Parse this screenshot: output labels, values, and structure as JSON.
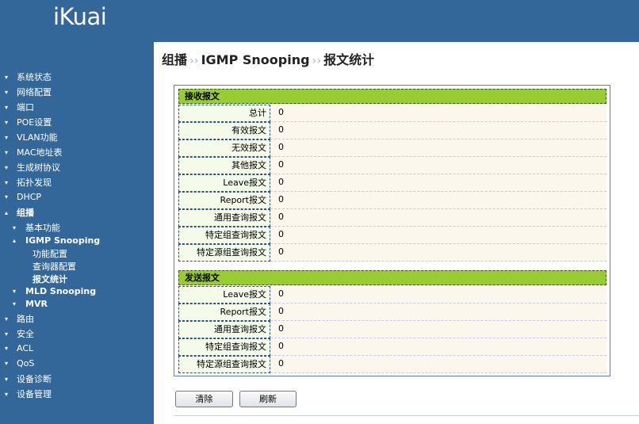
{
  "app": {
    "logo": "iKuai"
  },
  "breadcrumb": {
    "part1": "组播",
    "part2": "IGMP Snooping",
    "part3": "报文统计",
    "separator": "››"
  },
  "sidebar": {
    "items": [
      {
        "label": "系统状态",
        "arrow": "▾"
      },
      {
        "label": "网络配置",
        "arrow": "▾"
      },
      {
        "label": "端口",
        "arrow": "▾"
      },
      {
        "label": "POE设置",
        "arrow": "▾"
      },
      {
        "label": "VLAN功能",
        "arrow": "▾"
      },
      {
        "label": "MAC地址表",
        "arrow": "▾"
      },
      {
        "label": "生成树协议",
        "arrow": "▾"
      },
      {
        "label": "拓扑发现",
        "arrow": "▾"
      },
      {
        "label": "DHCP",
        "arrow": "▾"
      },
      {
        "label": "组播",
        "arrow": "▴"
      },
      {
        "label": "基本功能",
        "arrow": "▾"
      },
      {
        "label": "IGMP Snooping",
        "arrow": "▴"
      },
      {
        "label": "功能配置",
        "arrow": ""
      },
      {
        "label": "查询器配置",
        "arrow": ""
      },
      {
        "label": "报文统计",
        "arrow": ""
      },
      {
        "label": "MLD Snooping",
        "arrow": "▾"
      },
      {
        "label": "MVR",
        "arrow": "▾"
      },
      {
        "label": "路由",
        "arrow": "▾"
      },
      {
        "label": "安全",
        "arrow": "▾"
      },
      {
        "label": "ACL",
        "arrow": "▾"
      },
      {
        "label": "QoS",
        "arrow": "▾"
      },
      {
        "label": "设备诊断",
        "arrow": "▾"
      },
      {
        "label": "设备管理",
        "arrow": "▾"
      }
    ]
  },
  "receive": {
    "title": "接收报文",
    "rows": [
      {
        "label": "总计",
        "value": "0"
      },
      {
        "label": "有效报文",
        "value": "0"
      },
      {
        "label": "无效报文",
        "value": "0"
      },
      {
        "label": "其他报文",
        "value": "0"
      },
      {
        "label": "Leave报文",
        "value": "0"
      },
      {
        "label": "Report报文",
        "value": "0"
      },
      {
        "label": "通用查询报文",
        "value": "0"
      },
      {
        "label": "特定组查询报文",
        "value": "0"
      },
      {
        "label": "特定源组查询报文",
        "value": "0"
      }
    ]
  },
  "send": {
    "title": "发送报文",
    "rows": [
      {
        "label": "Leave报文",
        "value": "0"
      },
      {
        "label": "Report报文",
        "value": "0"
      },
      {
        "label": "通用查询报文",
        "value": "0"
      },
      {
        "label": "特定组查询报文",
        "value": "0"
      },
      {
        "label": "特定源组查询报文",
        "value": "0"
      }
    ]
  },
  "buttons": {
    "clear": "清除",
    "refresh": "刷新"
  },
  "colors": {
    "header_bg": "#336699",
    "section_bg": "#99cc33",
    "value_bg": "#fbf7ec",
    "label_bg": "#f4fbe8"
  }
}
